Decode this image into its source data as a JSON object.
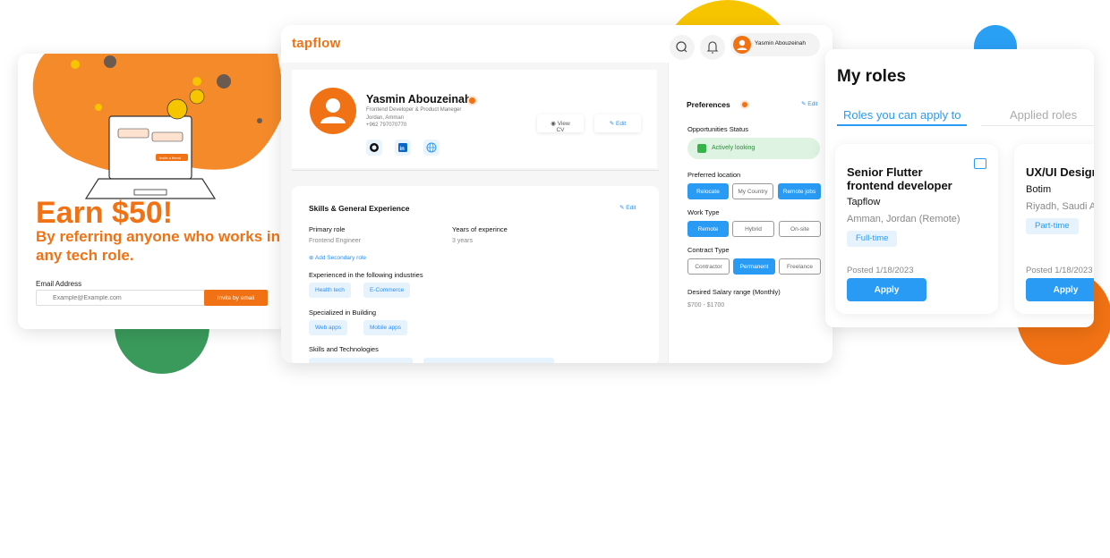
{
  "referral": {
    "headline": "Earn $50!",
    "subheadline": "By referring anyone who works in any tech role.",
    "email_label": "Email Address",
    "email_placeholder": "Example@Example.com",
    "invite_button": "Invite by email",
    "illustration_button": "Invite a friend"
  },
  "app": {
    "logo": "tapflow",
    "user_name": "Yasmin Abouzeinah"
  },
  "profile": {
    "name": "Yasmin Abouzeinah",
    "title": "Frontend Developer & Product Maneger",
    "location": "Jordan, Amman",
    "phone": "+962 797070770",
    "view_cv": "View CV",
    "edit": "Edit",
    "social_icons": [
      "github-icon",
      "linkedin-icon",
      "globe-icon"
    ]
  },
  "skills": {
    "heading": "Skills & General Experience",
    "edit": "Edit",
    "primary_role_label": "Primary role",
    "primary_role_value": "Frontend Engineer",
    "years_label": "Years of experince",
    "years_value": "3 years",
    "add_secondary": "Add Secondary role",
    "industries_label": "Experienced in the following industries",
    "industries": [
      "Health tech",
      "E-Commerce"
    ],
    "building_label": "Specialized in Building",
    "building": [
      "Web apps",
      "Mobile apps"
    ],
    "tech_label": "Skills and Technologies"
  },
  "preferences": {
    "heading": "Preferences",
    "edit": "Edit",
    "opp_status_label": "Opportunities Status",
    "opp_status_value": "Actively looking",
    "location_label": "Preferred location",
    "location_options": [
      "Relocate",
      "My Country",
      "Remote jobs"
    ],
    "worktype_label": "Work Type",
    "worktype_options": [
      "Remote",
      "Hybrid",
      "On-site"
    ],
    "contract_label": "Contract Type",
    "contract_options": [
      "Contractor",
      "Permanent",
      "Freelance"
    ],
    "salary_label": "Desired Salary range (Monthly)",
    "salary_value": "$700 -  $1700"
  },
  "roles": {
    "title": "My roles",
    "tab_active": "Roles you can apply to",
    "tab_inactive": "Applied roles",
    "cards": [
      {
        "title": "Senior Flutter frontend developer",
        "company": "Tapflow",
        "location": "Amman, Jordan (Remote)",
        "type": "Full-time",
        "posted": "Posted 1/18/2023",
        "apply": "Apply"
      },
      {
        "title": "UX/UI Design",
        "company": "Botim",
        "location": "Riyadh, Saudi A",
        "type": "Part-time",
        "posted": "Posted 1/18/2023",
        "apply": "Apply"
      }
    ]
  },
  "colors": {
    "brand_orange": "#f07214",
    "accent_blue": "#2a9bf5",
    "status_green": "#36b44a"
  }
}
